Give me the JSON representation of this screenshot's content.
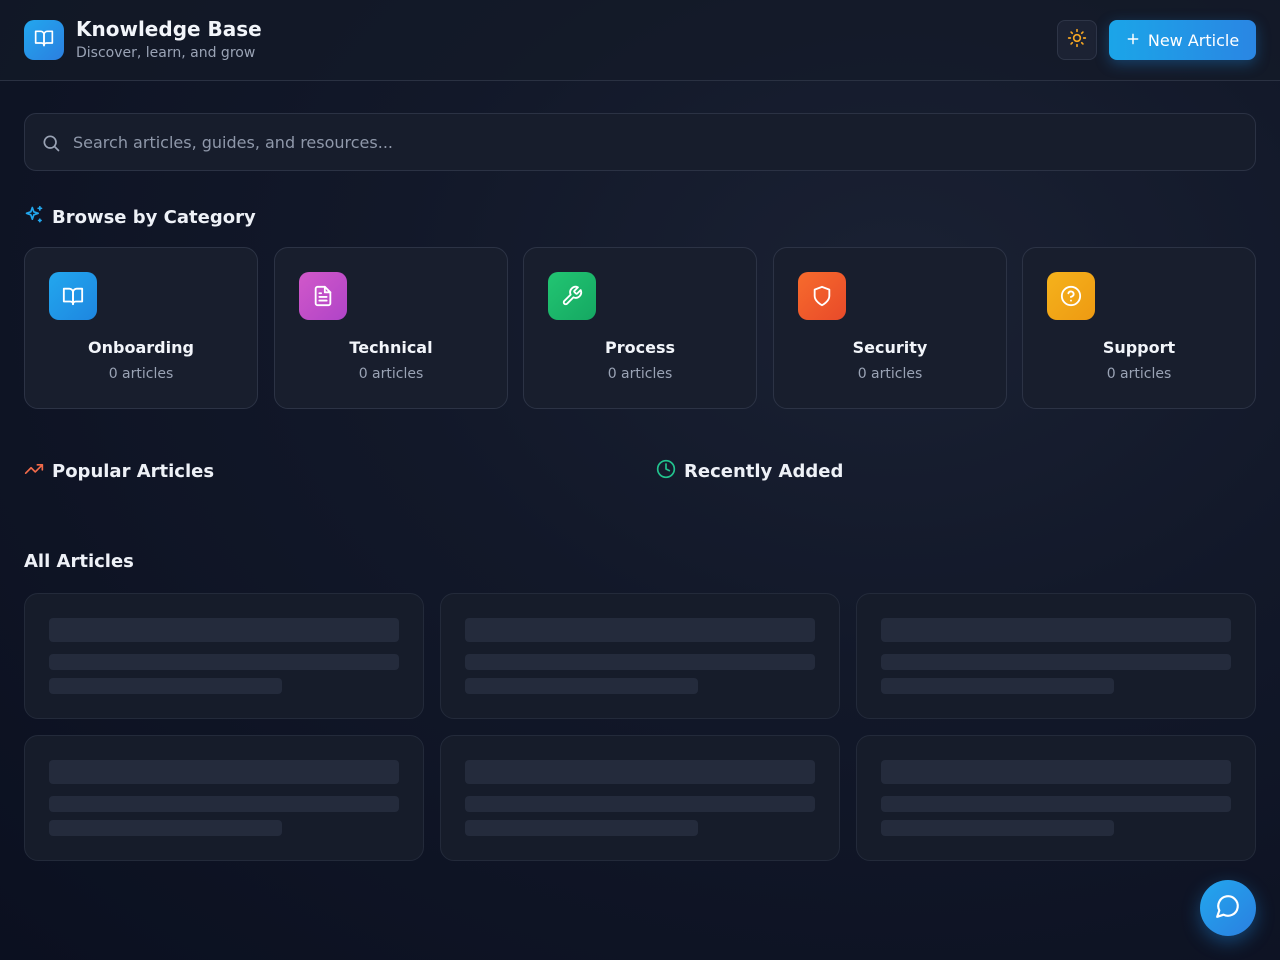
{
  "header": {
    "title": "Knowledge Base",
    "subtitle": "Discover, learn, and grow",
    "new_article_label": "New Article",
    "logo_icon": "book-open-icon",
    "theme_icon": "sun-icon"
  },
  "search": {
    "placeholder": "Search articles, guides, and resources...",
    "value": ""
  },
  "browse": {
    "title": "Browse by Category",
    "icon": "sparkles-icon"
  },
  "categories": [
    {
      "name": "Onboarding",
      "count": "0 articles",
      "icon": "book-open-icon",
      "color": "#1e9ae8"
    },
    {
      "name": "Technical",
      "count": "0 articles",
      "icon": "file-text-icon",
      "color": "#c24fc9"
    },
    {
      "name": "Process",
      "count": "0 articles",
      "icon": "wrench-icon",
      "color": "#1ebf6e"
    },
    {
      "name": "Security",
      "count": "0 articles",
      "icon": "shield-icon",
      "color": "#f0582a"
    },
    {
      "name": "Support",
      "count": "0 articles",
      "icon": "help-circle-icon",
      "color": "#f2a41a"
    }
  ],
  "popular": {
    "title": "Popular Articles",
    "icon": "trending-up-icon",
    "icon_color": "#f26b4a"
  },
  "recent": {
    "title": "Recently Added",
    "icon": "clock-icon",
    "icon_color": "#22c38e"
  },
  "all_articles": {
    "title": "All Articles",
    "loading_placeholders": 6
  },
  "chat": {
    "icon": "message-circle-icon"
  },
  "colors": {
    "accent": "#1ba5e8",
    "background": "#0f1525",
    "card": "#181e2d"
  }
}
